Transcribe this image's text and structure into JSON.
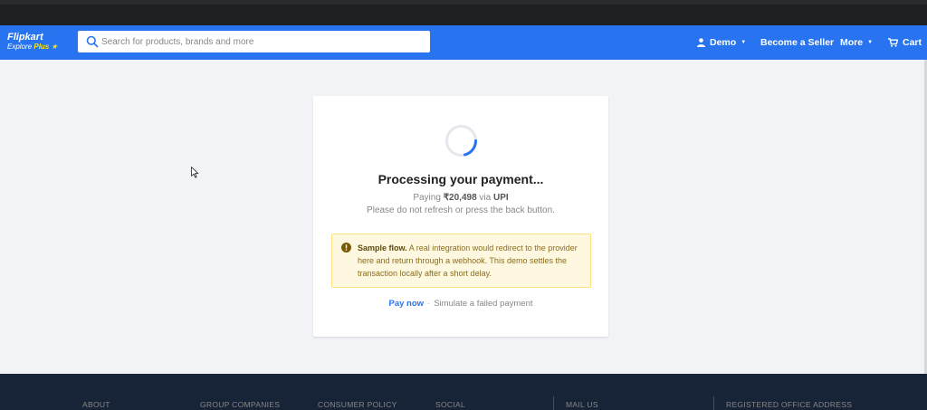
{
  "header": {
    "brand": "Flipkart",
    "tagline_explore": "Explore",
    "tagline_plus": "Plus",
    "search_placeholder": "Search for products, brands and more",
    "nav": {
      "user": "Demo",
      "seller": "Become a Seller",
      "more": "More",
      "cart": "Cart"
    }
  },
  "payment": {
    "title": "Processing your payment...",
    "paying_prefix": "Paying",
    "amount": "₹20,498",
    "via": "via",
    "method": "UPI",
    "instruction": "Please do not refresh or press the back button.",
    "notice_title": "Sample flow.",
    "notice_body": "A real integration would redirect to the provider here and return through a webhook. This demo settles the transaction locally after a short delay.",
    "pay_now": "Pay now",
    "separator": "·",
    "simulate_failed": "Simulate a failed payment"
  },
  "footer": {
    "headings": [
      "ABOUT",
      "GROUP COMPANIES",
      "CONSUMER POLICY",
      "SOCIAL",
      "MAIL US",
      "REGISTERED OFFICE ADDRESS"
    ]
  },
  "colors": {
    "primary": "#2874f0",
    "star": "#ffe500",
    "footer": "#172337",
    "notice_bg": "#fff8e1"
  },
  "icons": [
    "search-icon",
    "user-icon",
    "caret-down-icon",
    "cart-icon",
    "warning-icon",
    "spinner-icon",
    "mouse-cursor-icon"
  ]
}
